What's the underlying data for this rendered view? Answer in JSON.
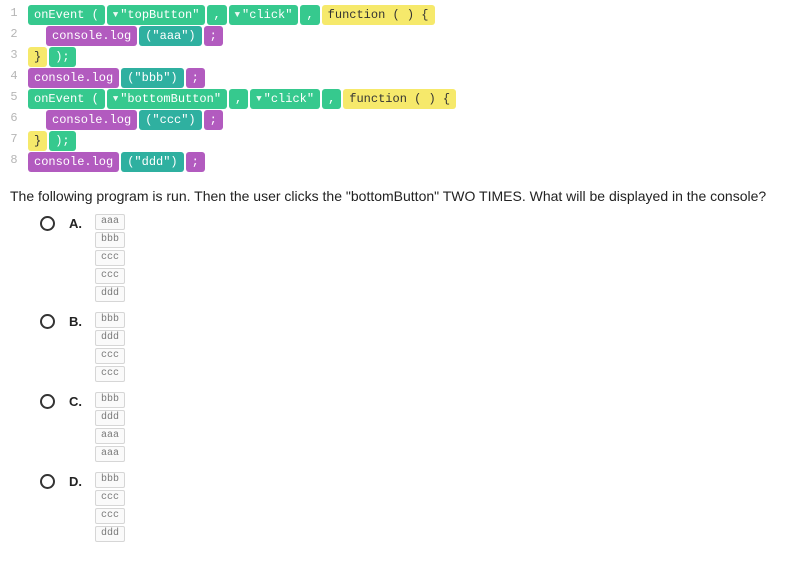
{
  "code": {
    "lines": [
      {
        "n": "1",
        "indent": 0,
        "segs": [
          {
            "cls": "green",
            "text": "onEvent (",
            "dd": false
          },
          {
            "cls": "green",
            "text": "\"topButton\"",
            "dd": true
          },
          {
            "cls": "green",
            "text": ",",
            "dd": false
          },
          {
            "cls": "green",
            "text": "\"click\"",
            "dd": true
          },
          {
            "cls": "green",
            "text": ",",
            "dd": false
          },
          {
            "cls": "yellow",
            "text": "function ( ) {",
            "dd": false
          }
        ]
      },
      {
        "n": "2",
        "indent": 1,
        "segs": [
          {
            "cls": "purple",
            "text": "console.log",
            "dd": false
          },
          {
            "cls": "teal",
            "text": "(\"aaa\")",
            "dd": false
          },
          {
            "cls": "purple",
            "text": ";",
            "dd": false
          }
        ]
      },
      {
        "n": "3",
        "indent": 0,
        "segs": [
          {
            "cls": "yellow",
            "text": "}",
            "dd": false
          },
          {
            "cls": "green",
            "text": ");",
            "dd": false
          }
        ]
      },
      {
        "n": "4",
        "indent": 0,
        "segs": [
          {
            "cls": "purple",
            "text": "console.log",
            "dd": false
          },
          {
            "cls": "teal",
            "text": "(\"bbb\")",
            "dd": false
          },
          {
            "cls": "purple",
            "text": ";",
            "dd": false
          }
        ]
      },
      {
        "n": "5",
        "indent": 0,
        "segs": [
          {
            "cls": "green",
            "text": "onEvent (",
            "dd": false
          },
          {
            "cls": "green",
            "text": "\"bottomButton\"",
            "dd": true
          },
          {
            "cls": "green",
            "text": ",",
            "dd": false
          },
          {
            "cls": "green",
            "text": "\"click\"",
            "dd": true
          },
          {
            "cls": "green",
            "text": ",",
            "dd": false
          },
          {
            "cls": "yellow",
            "text": "function ( ) {",
            "dd": false
          }
        ]
      },
      {
        "n": "6",
        "indent": 1,
        "segs": [
          {
            "cls": "purple",
            "text": "console.log",
            "dd": false
          },
          {
            "cls": "teal",
            "text": "(\"ccc\")",
            "dd": false
          },
          {
            "cls": "purple",
            "text": ";",
            "dd": false
          }
        ]
      },
      {
        "n": "7",
        "indent": 0,
        "segs": [
          {
            "cls": "yellow",
            "text": "}",
            "dd": false
          },
          {
            "cls": "green",
            "text": ");",
            "dd": false
          }
        ]
      },
      {
        "n": "8",
        "indent": 0,
        "segs": [
          {
            "cls": "purple",
            "text": "console.log",
            "dd": false
          },
          {
            "cls": "teal",
            "text": "(\"ddd\")",
            "dd": false
          },
          {
            "cls": "purple",
            "text": ";",
            "dd": false
          }
        ]
      }
    ]
  },
  "question_text": "The following program is run. Then the user clicks the \"bottomButton\" TWO TIMES. What will be displayed in the console?",
  "answers": [
    {
      "label": "A.",
      "lines": [
        "aaa",
        "bbb",
        "ccc",
        "ccc",
        "ddd"
      ]
    },
    {
      "label": "B.",
      "lines": [
        "bbb",
        "ddd",
        "ccc",
        "ccc"
      ]
    },
    {
      "label": "C.",
      "lines": [
        "bbb",
        "ddd",
        "aaa",
        "aaa"
      ]
    },
    {
      "label": "D.",
      "lines": [
        "bbb",
        "ccc",
        "ccc",
        "ddd"
      ]
    }
  ]
}
